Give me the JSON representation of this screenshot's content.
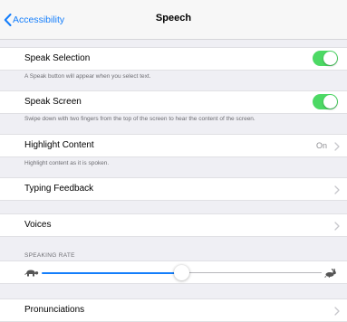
{
  "colors": {
    "accent": "#147efb",
    "toggle_on": "#4cd964",
    "background": "#efeff4",
    "secondary_text": "#8e8e93"
  },
  "navbar": {
    "back_label": "Accessibility",
    "back_icon": "chevron-left-icon",
    "title": "Speech"
  },
  "speak_selection": {
    "label": "Speak Selection",
    "enabled": true,
    "footer": "A Speak button will appear when you select text."
  },
  "speak_screen": {
    "label": "Speak Screen",
    "enabled": true,
    "footer": "Swipe down with two fingers from the top of the screen to hear the content of the screen."
  },
  "highlight_content": {
    "label": "Highlight Content",
    "value": "On",
    "footer": "Highlight content as it is spoken."
  },
  "typing_feedback": {
    "label": "Typing Feedback"
  },
  "voices": {
    "label": "Voices"
  },
  "speaking_rate": {
    "header": "SPEAKING RATE",
    "value_fraction": 0.5,
    "min_icon": "turtle-icon",
    "max_icon": "hare-icon"
  },
  "pronunciations": {
    "label": "Pronunciations"
  }
}
